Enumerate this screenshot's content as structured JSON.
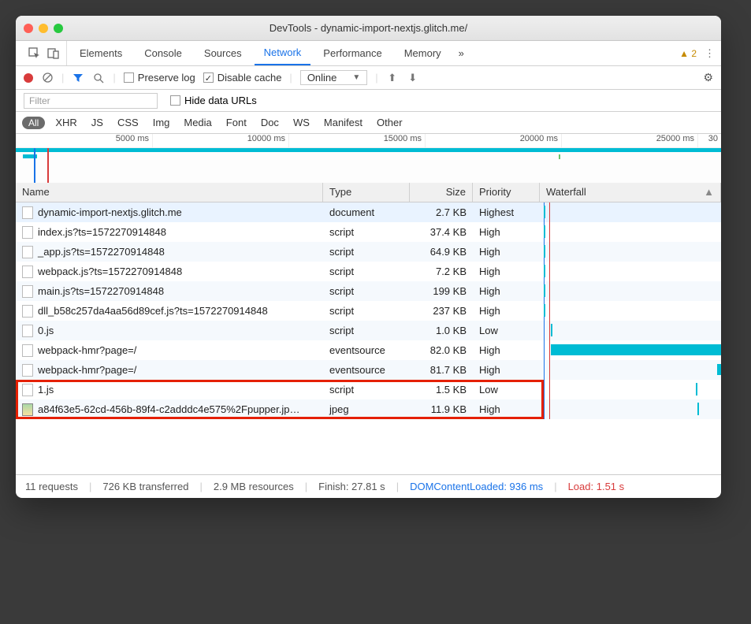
{
  "window_title": "DevTools - dynamic-import-nextjs.glitch.me/",
  "tabs": [
    "Elements",
    "Console",
    "Sources",
    "Network",
    "Performance",
    "Memory"
  ],
  "active_tab": "Network",
  "warnings_count": "2",
  "toolbar": {
    "preserve_log": "Preserve log",
    "disable_cache": "Disable cache",
    "throttle": "Online"
  },
  "filter": {
    "placeholder": "Filter",
    "hide_data_urls_label": "Hide data URLs"
  },
  "type_filters": [
    "All",
    "XHR",
    "JS",
    "CSS",
    "Img",
    "Media",
    "Font",
    "Doc",
    "WS",
    "Manifest",
    "Other"
  ],
  "timeline_ticks": [
    "5000 ms",
    "10000 ms",
    "15000 ms",
    "20000 ms",
    "25000 ms",
    "30"
  ],
  "columns": {
    "name": "Name",
    "type": "Type",
    "size": "Size",
    "priority": "Priority",
    "waterfall": "Waterfall"
  },
  "rows": [
    {
      "name": "dynamic-import-nextjs.glitch.me",
      "type": "document",
      "size": "2.7 KB",
      "priority": "Highest",
      "icon": "doc",
      "wf": {
        "l": 2,
        "t": true
      }
    },
    {
      "name": "index.js?ts=1572270914848",
      "type": "script",
      "size": "37.4 KB",
      "priority": "High",
      "icon": "doc",
      "wf": {
        "l": 2,
        "t": true
      }
    },
    {
      "name": "_app.js?ts=1572270914848",
      "type": "script",
      "size": "64.9 KB",
      "priority": "High",
      "icon": "doc",
      "wf": {
        "l": 2,
        "t": true
      }
    },
    {
      "name": "webpack.js?ts=1572270914848",
      "type": "script",
      "size": "7.2 KB",
      "priority": "High",
      "icon": "doc",
      "wf": {
        "l": 2,
        "t": true
      }
    },
    {
      "name": "main.js?ts=1572270914848",
      "type": "script",
      "size": "199 KB",
      "priority": "High",
      "icon": "doc",
      "wf": {
        "l": 2,
        "t": true
      }
    },
    {
      "name": "dll_b58c257da4aa56d89cef.js?ts=1572270914848",
      "type": "script",
      "size": "237 KB",
      "priority": "High",
      "icon": "doc",
      "wf": {
        "l": 2,
        "t": true
      }
    },
    {
      "name": "0.js",
      "type": "script",
      "size": "1.0 KB",
      "priority": "Low",
      "icon": "doc",
      "wf": {
        "l": 6,
        "t": true
      }
    },
    {
      "name": "webpack-hmr?page=/",
      "type": "eventsource",
      "size": "82.0 KB",
      "priority": "High",
      "icon": "doc",
      "wf": {
        "l": 6,
        "w": 95
      }
    },
    {
      "name": "webpack-hmr?page=/",
      "type": "eventsource",
      "size": "81.7 KB",
      "priority": "High",
      "icon": "doc",
      "wf": {
        "l": 98,
        "w": 4
      }
    },
    {
      "name": "1.js",
      "type": "script",
      "size": "1.5 KB",
      "priority": "Low",
      "icon": "doc",
      "wf": {
        "l": 86,
        "t": true
      }
    },
    {
      "name": "a84f63e5-62cd-456b-89f4-c2adddc4e575%2Fpupper.jp…",
      "type": "jpeg",
      "size": "11.9 KB",
      "priority": "High",
      "icon": "img",
      "wf": {
        "l": 87,
        "t": true
      }
    }
  ],
  "highlight_rows": [
    9,
    10
  ],
  "status_bar": {
    "requests": "11 requests",
    "transferred": "726 KB transferred",
    "resources": "2.9 MB resources",
    "finish": "Finish: 27.81 s",
    "dcl": "DOMContentLoaded: 936 ms",
    "load": "Load: 1.51 s"
  }
}
